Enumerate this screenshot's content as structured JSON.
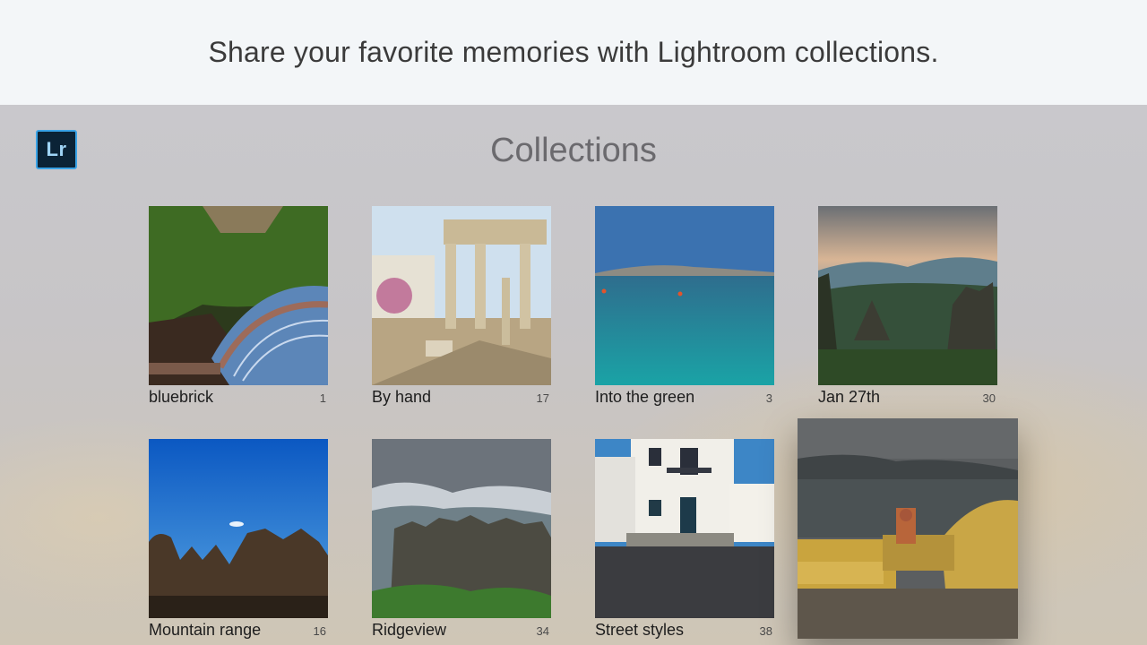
{
  "banner": {
    "text": "Share your favorite memories with Lightroom collections."
  },
  "app": {
    "logo_text": "Lr"
  },
  "page": {
    "title": "Collections"
  },
  "collections": [
    {
      "name": "bluebrick",
      "count": "1"
    },
    {
      "name": "By hand",
      "count": "17"
    },
    {
      "name": "Into the green",
      "count": "3"
    },
    {
      "name": "Jan 27th",
      "count": "30"
    },
    {
      "name": "Mountain range",
      "count": "16"
    },
    {
      "name": "Ridgeview",
      "count": "34"
    },
    {
      "name": "Street styles",
      "count": "38"
    },
    {
      "name": "",
      "count": ""
    }
  ],
  "colors": {
    "logo_bg": "#0b2336",
    "logo_accent": "#3aa3e6"
  }
}
